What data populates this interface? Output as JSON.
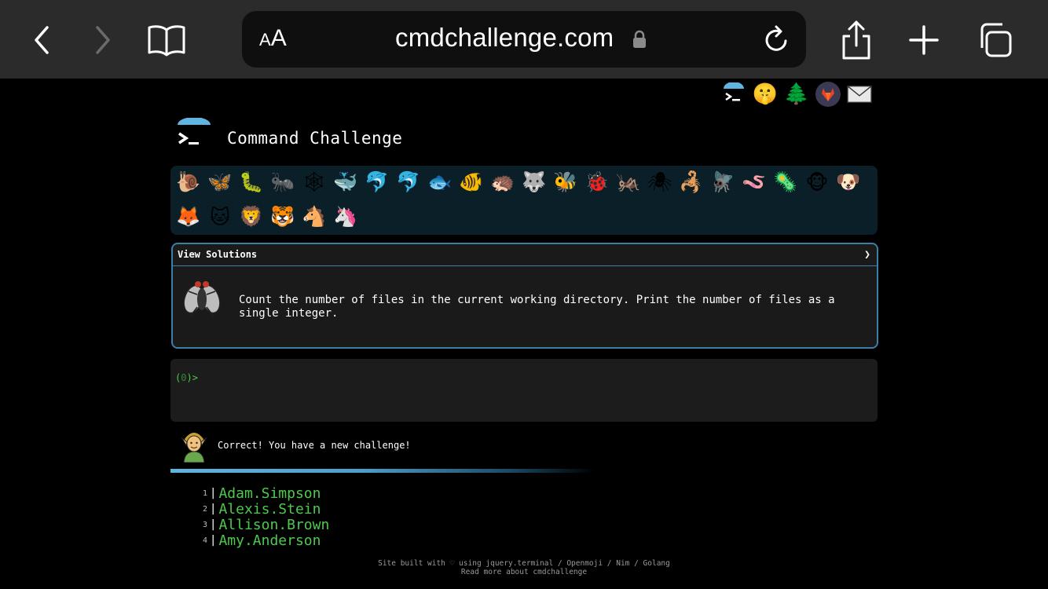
{
  "browser": {
    "text_size_label_small": "A",
    "text_size_label_big": "A",
    "url": "cmdchallenge.com",
    "icons": [
      "back-icon",
      "forward-icon",
      "bookmarks-icon",
      "lock-icon",
      "reload-icon",
      "share-icon",
      "new-tab-icon",
      "tabs-icon"
    ]
  },
  "site": {
    "title": "Command Challenge",
    "social_icons": [
      "terminal-logo-icon",
      "shushing-face-icon",
      "tree-icon",
      "gitlab-icon",
      "envelope-icon"
    ]
  },
  "animals": {
    "row1": [
      "🐌",
      "🦋",
      "🐛",
      "🐜",
      "🕸",
      "🐳",
      "🐬",
      "🐬",
      "🐟",
      "🐠",
      "🦔",
      "🐺",
      "🐝",
      "🐞",
      "🦗",
      "🕷",
      "🦂",
      "🪰",
      "🪱",
      "🦠",
      "🐵",
      "🐶"
    ],
    "row2": [
      "🦊",
      "🐱",
      "🦁",
      "🐯",
      "🐴",
      "🦄"
    ]
  },
  "panel": {
    "label": "View Solutions",
    "chevron": "❯",
    "challenge_text": "Count the number of files in the current working directory. Print the number of files as a single integer."
  },
  "terminal": {
    "prompt_open": "(",
    "prompt_num": "0",
    "prompt_close": ")>"
  },
  "result": {
    "message": "Correct! You have a new challenge!"
  },
  "output": [
    {
      "n": "1",
      "name": "Adam.Simpson"
    },
    {
      "n": "2",
      "name": "Alexis.Stein"
    },
    {
      "n": "3",
      "name": "Allison.Brown"
    },
    {
      "n": "4",
      "name": "Amy.Anderson"
    }
  ],
  "footer": {
    "line1": "Site built with ♡ using jquery.terminal / Openmoji / Nim / Golang",
    "line2": "Read more about cmdchallenge"
  }
}
